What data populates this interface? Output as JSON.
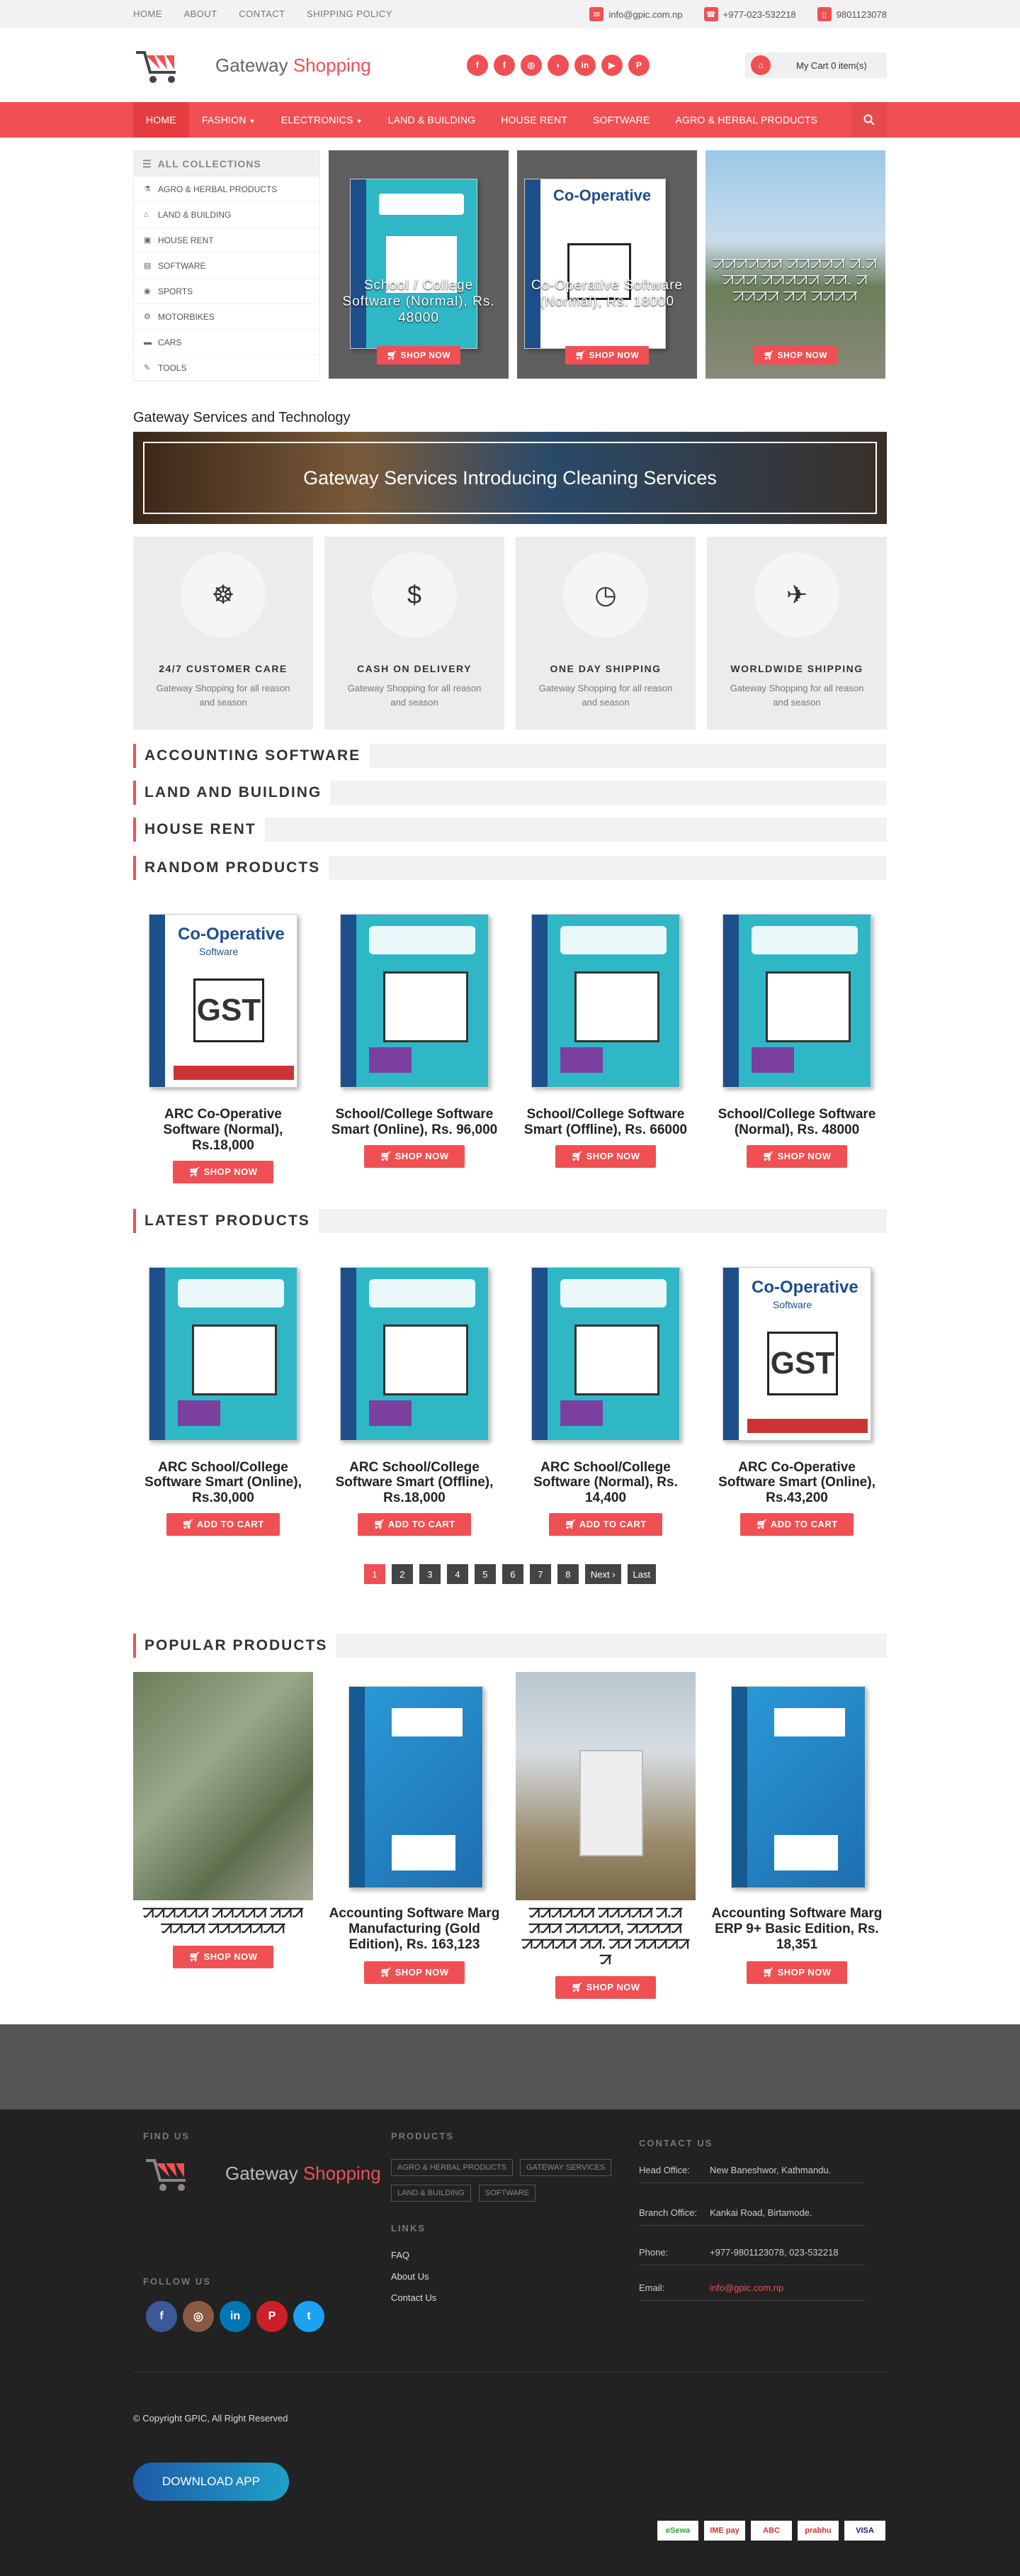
{
  "topbar": {
    "links": [
      "HOME",
      "ABOUT",
      "CONTACT",
      "SHIPPING POLICY"
    ],
    "email": "info@gpic.com.np",
    "phone": "+977-023-532218",
    "mobile": "9801123078"
  },
  "header": {
    "logo_text": "Gateway",
    "logo_accent": "Shopping",
    "socials": [
      "f",
      "f",
      "i",
      "r",
      "in",
      "yt",
      "p"
    ],
    "cart": "My Cart 0 item(s)"
  },
  "nav": {
    "items": [
      "HOME",
      "FASHION",
      "ELECTRONICS",
      "LAND & BUILDING",
      "HOUSE RENT",
      "SOFTWARE",
      "AGRO & HERBAL PRODUCTS"
    ]
  },
  "collections": {
    "title": "ALL COLLECTIONS",
    "items": [
      "AGRO & HERBAL PRODUCTS",
      "LAND & BUILDING",
      "HOUSE RENT",
      "SOFTWARE",
      "SPORTS",
      "MOTORBIKES",
      "CARS",
      "TOOLS"
    ]
  },
  "hero": [
    {
      "title": "School / College Software (Normal), Rs. 48000",
      "btn": "SHOP NOW"
    },
    {
      "title": "Co-Operative Software (Normal), Rs. 18000",
      "btn": "SHOP NOW"
    },
    {
      "title": "ꠀꠀꠀꠀꠀꠀ ꠀꠀꠀꠀꠀ ꠀ.ꠀ ꠀꠀꠀ ꠀꠀꠀꠀꠀ ꠀꠀ. ꠀ ꠀꠀꠀꠀ ꠀꠀ ꠀꠀꠀꠀ",
      "btn": "SHOP NOW"
    }
  ],
  "services": {
    "title": "Gateway Services and Technology",
    "banner": "Gateway Services Introducing Cleaning Services",
    "features": [
      {
        "icon": "☸",
        "title": "24/7 CUSTOMER CARE",
        "desc": "Gateway Shopping for all reason and season"
      },
      {
        "icon": "$",
        "title": "CASH ON DELIVERY",
        "desc": "Gateway Shopping for all reason and season"
      },
      {
        "icon": "◷",
        "title": "ONE DAY SHIPPING",
        "desc": "Gateway Shopping for all reason and season"
      },
      {
        "icon": "✈",
        "title": "WORLDWIDE SHIPPING",
        "desc": "Gateway Shopping for all reason and season"
      }
    ]
  },
  "sections": {
    "accounting": "ACCOUNTING SOFTWARE",
    "land": "LAND AND BUILDING",
    "house": "HOUSE RENT",
    "random": "RANDOM PRODUCTS",
    "latest": "LATEST PRODUCTS",
    "popular": "POPULAR PRODUCTS"
  },
  "random": [
    {
      "name": "ARC Co-Operative Software (Normal), Rs.18,000",
      "btn": "SHOP NOW",
      "box": "coop"
    },
    {
      "name": "School/College Software Smart (Online), Rs. 96,000",
      "btn": "SHOP NOW",
      "box": "school"
    },
    {
      "name": "School/College Software Smart (Offline), Rs. 66000",
      "btn": "SHOP NOW",
      "box": "school"
    },
    {
      "name": "School/College Software (Normal), Rs. 48000",
      "btn": "SHOP NOW",
      "box": "school"
    }
  ],
  "latest": [
    {
      "name": "ARC School/College Software Smart (Online), Rs.30,000",
      "btn": "ADD TO CART",
      "box": "school"
    },
    {
      "name": "ARC School/College Software Smart (Offline), Rs.18,000",
      "btn": "ADD TO CART",
      "box": "school"
    },
    {
      "name": "ARC School/College Software (Normal), Rs. 14,400",
      "btn": "ADD TO CART",
      "box": "school"
    },
    {
      "name": "ARC Co-Operative Software Smart (Online), Rs.43,200",
      "btn": "ADD TO CART",
      "box": "coop"
    }
  ],
  "pager": [
    "1",
    "2",
    "3",
    "4",
    "5",
    "6",
    "7",
    "8",
    "Next ›",
    "Last"
  ],
  "popular": [
    {
      "name": "ꠀꠀꠀꠀꠀꠀ ꠀꠀꠀꠀꠀ ꠀꠀꠀ ꠀꠀꠀꠀ ꠀꠀꠀꠀꠀꠀꠀ",
      "btn": "SHOP NOW",
      "img": "aerial"
    },
    {
      "name": "Accounting Software Marg Manufacturing (Gold Edition), Rs. 163,123",
      "btn": "SHOP NOW",
      "img": "marg"
    },
    {
      "name": "ꠀꠀꠀꠀꠀꠀ ꠀꠀꠀꠀꠀ ꠀ.ꠀ ꠀꠀꠀ ꠀꠀꠀꠀꠀ, ꠀꠀꠀꠀꠀ ꠀꠀꠀꠀꠀ ꠀꠀ. ꠀꠀ ꠀꠀꠀꠀꠀ ꠀ",
      "btn": "SHOP NOW",
      "img": "house"
    },
    {
      "name": "Accounting Software Marg ERP 9+ Basic Edition, Rs. 18,351",
      "btn": "SHOP NOW",
      "img": "marg"
    }
  ],
  "footer": {
    "find_us": "FIND US",
    "products": "PRODUCTS",
    "links": "LINKS",
    "contact": "CONTACT US",
    "follow": "FOLLOW US",
    "tags": [
      "AGRO & HERBAL PRODUCTS",
      "GATEWAY SERVICES",
      "LAND & BUILDING",
      "SOFTWARE"
    ],
    "link_items": [
      "FAQ",
      "About Us",
      "Contact Us"
    ],
    "contact_rows": [
      {
        "k": "Head Office:",
        "v": "New Baneshwor, Kathmandu."
      },
      {
        "k": "Branch Office:",
        "v": "Kankai Road, Birtamode."
      },
      {
        "k": "Phone:",
        "v": "+977-9801123078, 023-532218"
      },
      {
        "k": "Email:",
        "v": "info@gpic.com.np"
      }
    ],
    "copyright": "© Copyright GPIC, All Right Reserved",
    "download": "DOWNLOAD APP",
    "payments": [
      "eSewa",
      "IME pay",
      "ABC",
      "prabhu",
      "VISA"
    ]
  },
  "colors": {
    "accent": "#f05053",
    "dark": "#222222"
  }
}
